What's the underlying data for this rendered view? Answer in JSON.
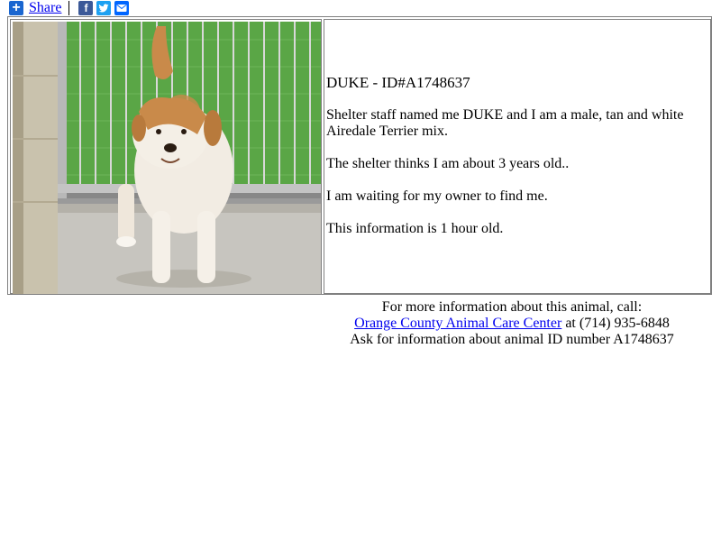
{
  "share": {
    "label": "Share",
    "icons": [
      "facebook-icon",
      "twitter-icon",
      "email-icon"
    ]
  },
  "animal": {
    "heading": "DUKE - ID#A1748637",
    "paragraphs": [
      "Shelter staff named me DUKE and I am a male, tan and white Airedale Terrier mix.",
      "The shelter thinks I am about 3 years old..",
      "I am waiting for my owner to find me.",
      "This information is 1 hour old."
    ]
  },
  "contact": {
    "line1": "For more information about this animal, call:",
    "shelter_link": "Orange County Animal Care Center",
    "phone_text": " at (714) 935-6848",
    "line3": "Ask for information about animal ID number A1748637"
  },
  "colors": {
    "link": "#0000ee",
    "share_blue": "#1a66d0",
    "facebook": "#3b5998",
    "twitter": "#1da1f2",
    "email": "#0166ff"
  }
}
